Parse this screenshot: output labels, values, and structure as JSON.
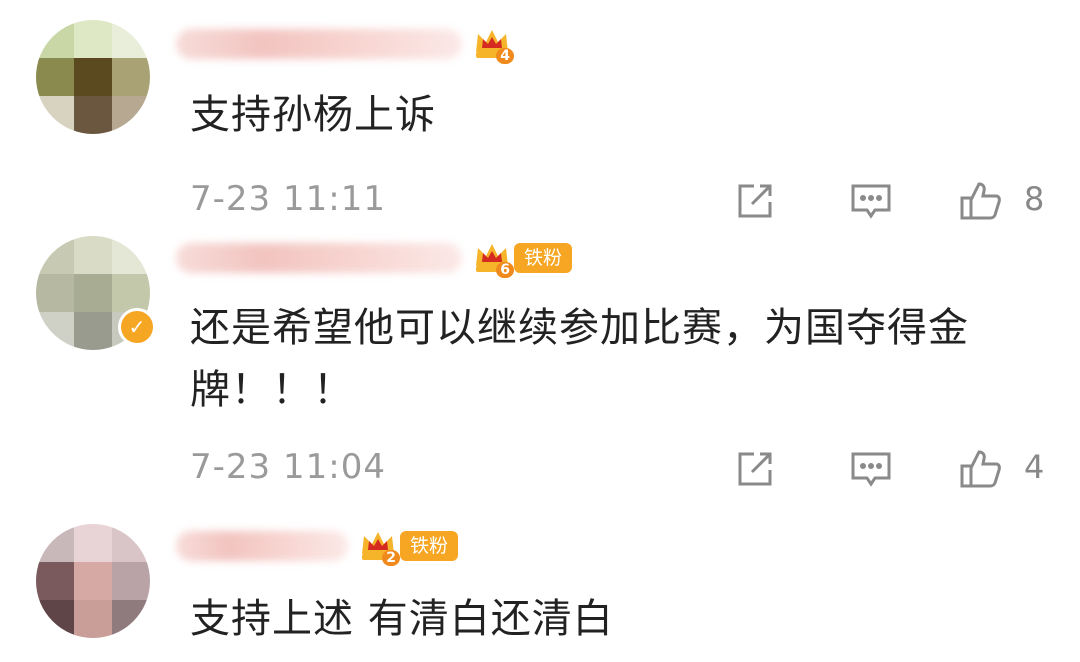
{
  "comments": [
    {
      "level": "4",
      "badge": "",
      "text": "支持孙杨上诉",
      "time": "7-23 11:11",
      "likes": "8"
    },
    {
      "level": "6",
      "badge": "铁粉",
      "text": "还是希望他可以继续参加比赛，为国夺得金牌！！！",
      "time": "7-23 11:04",
      "likes": "4"
    },
    {
      "level": "2",
      "badge": "铁粉",
      "text": "支持上述 有清白还清白",
      "time": "",
      "likes": ""
    }
  ],
  "icons": {
    "share": "share-icon",
    "comment": "comment-icon",
    "like": "thumbs-up-icon",
    "crown": "crown-level-icon",
    "verified": "verified-check-icon"
  },
  "colors": {
    "text": "#222222",
    "meta": "#9a9a9a",
    "badge": "#f6a623",
    "crown": "#d42a1f"
  }
}
